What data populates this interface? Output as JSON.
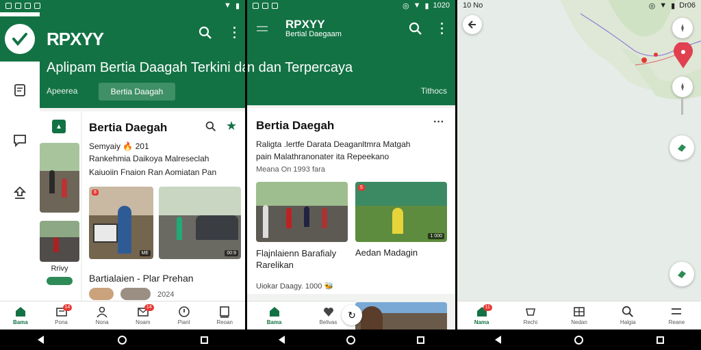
{
  "panel1": {
    "app_title": "RPXYY",
    "subtitle": "Aplipam Bertia Daagah Terkini dan",
    "tabs": [
      {
        "label": "Apeerea",
        "active": false
      },
      {
        "label": "Bertia Daagah",
        "active": true
      }
    ],
    "thumb_label": "Rrivy",
    "card_title": "Bertia Daegah",
    "card_meta": "Semyaiy 🔥 201",
    "card_line1": "Rankehmia Daikoya Malreseclah",
    "card_line2": "Kaiuoiin Fnaion Ran Aomiatan Pan",
    "story2_title": "Bartialaien - Plar Prehan",
    "story2_meta": "2024",
    "photo1_tag": "ME",
    "photo2_tag": "00:9",
    "photo1_red": "8",
    "bottom_nav": [
      {
        "label": "Bama",
        "icon": "home-icon",
        "badge": ""
      },
      {
        "label": "Pona",
        "icon": "news-icon",
        "badge": "14"
      },
      {
        "label": "Nona",
        "icon": "person-icon",
        "badge": ""
      },
      {
        "label": "Noam",
        "icon": "mail-icon",
        "badge": "14"
      },
      {
        "label": "Pianl",
        "icon": "info-icon",
        "badge": ""
      },
      {
        "label": "Reoan",
        "icon": "bookmark-icon",
        "badge": ""
      }
    ]
  },
  "panel2": {
    "header_title": "RPXYY",
    "header_sub": "Bertial Daegaam",
    "subtitle": "n dan Terpercaya",
    "tab_right": "Tithocs",
    "card_title": "Bertia Daegah",
    "desc_line1": "Raligta .lertfe Darata Deaganltmra Matgah",
    "desc_line2": "pain Malathranonater ita Repeekano",
    "meta": "Meana On 1993 fara",
    "caption1": "Flajnlaienn Barafialy Rarelikan",
    "caption2": "Aedan Madagin",
    "footer_meta": "Uiokar Daagy. 1000 🐝",
    "photo2_tag": "1 000",
    "photo2_red": "5",
    "bottom_nav": [
      {
        "label": "Bama",
        "icon": "home-icon"
      },
      {
        "label": "Belivas",
        "icon": "heart-icon"
      }
    ]
  },
  "panel3": {
    "status_left": "10 No",
    "status_time": "Dr06",
    "bottom_nav": [
      {
        "label": "Nama",
        "icon": "home-icon",
        "badge": "11"
      },
      {
        "label": "Rechi",
        "icon": "cup-icon",
        "badge": ""
      },
      {
        "label": "Nedan",
        "icon": "grid-icon",
        "badge": ""
      },
      {
        "label": "Halgia",
        "icon": "search-icon",
        "badge": ""
      },
      {
        "label": "Reane",
        "icon": "menu-icon",
        "badge": ""
      }
    ]
  },
  "status_time_p2": "1020",
  "colors": {
    "brand": "#137244",
    "accent": "#e53935",
    "pin": "#e0404f"
  }
}
